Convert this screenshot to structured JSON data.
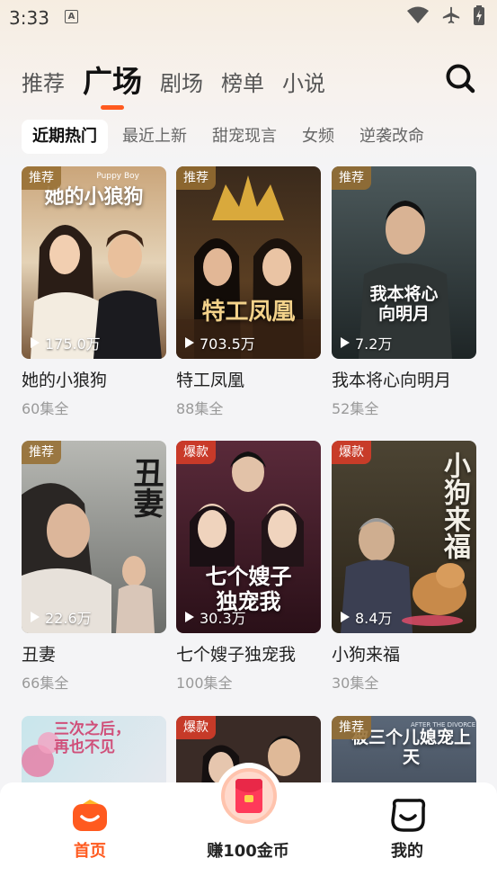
{
  "status_bar": {
    "time": "3:33",
    "a_icon": "A"
  },
  "main_tabs": [
    {
      "label": "推荐"
    },
    {
      "label": "广场"
    },
    {
      "label": "剧场"
    },
    {
      "label": "榜单"
    },
    {
      "label": "小说"
    }
  ],
  "active_main_tab": "广场",
  "categories": [
    {
      "label": "近期热门"
    },
    {
      "label": "最近上新"
    },
    {
      "label": "甜宠现言"
    },
    {
      "label": "女频"
    },
    {
      "label": "逆袭改命"
    }
  ],
  "active_category": "近期热门",
  "cards": [
    {
      "badge": "推荐",
      "views": "175.0万",
      "title": "她的小狼狗",
      "episodes": "60集全",
      "poster_text": "她的小狼狗",
      "top_caption": "Puppy Boy"
    },
    {
      "badge": "推荐",
      "views": "703.5万",
      "title": "特工凤凰",
      "episodes": "88集全",
      "poster_text": "特工凤凰"
    },
    {
      "badge": "推荐",
      "views": "7.2万",
      "title": "我本将心向明月",
      "episodes": "52集全",
      "poster_text": "我本将心\n向明月"
    },
    {
      "badge": "推荐",
      "views": "22.6万",
      "title": "丑妻",
      "episodes": "66集全",
      "poster_text": "丑妻"
    },
    {
      "badge": "爆款",
      "views": "30.3万",
      "title": "七个嫂子独宠我",
      "episodes": "100集全",
      "poster_text": "七个嫂子\n独宠我"
    },
    {
      "badge": "爆款",
      "views": "8.4万",
      "title": "小狗来福",
      "episodes": "30集全",
      "poster_text": "小狗来福"
    },
    {
      "badge": "",
      "views": "",
      "title": "",
      "episodes": "",
      "poster_text": "三次之后，\n再也不见"
    },
    {
      "badge": "爆款",
      "views": "",
      "title": "",
      "episodes": "",
      "poster_text": ""
    },
    {
      "badge": "推荐",
      "views": "",
      "title": "",
      "episodes": "",
      "poster_text": "被三个儿媳宠上天",
      "top_caption": "AFTER THE DIVORCE"
    }
  ],
  "bottom_nav": {
    "home": "首页",
    "earn": "赚100金币",
    "mine": "我的"
  },
  "colors": {
    "accent": "#ff5a1f",
    "badge_recommend": "#966e32",
    "badge_hot": "#d23c28"
  }
}
